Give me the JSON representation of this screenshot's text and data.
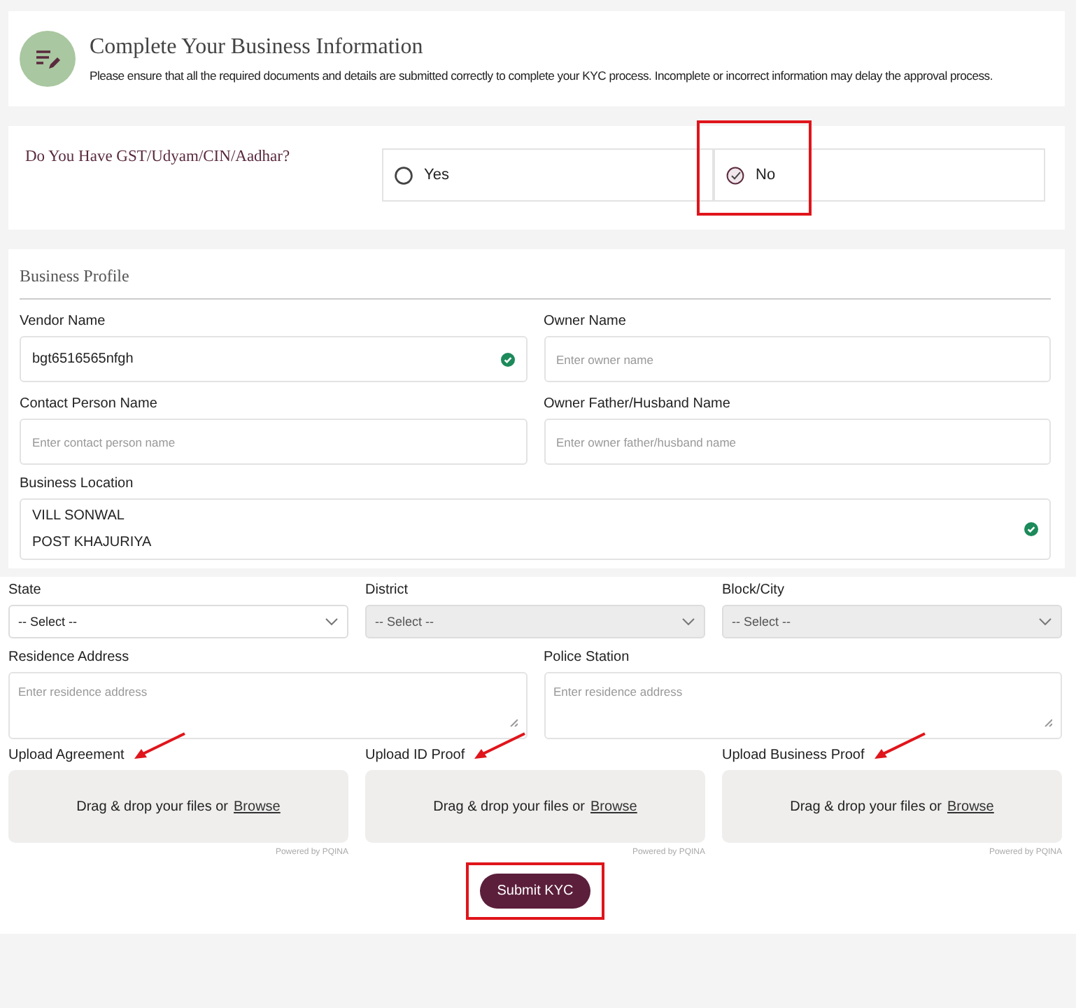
{
  "header": {
    "title": "Complete Your Business Information",
    "description": "Please ensure that all the required documents and details are submitted correctly to complete your KYC process. Incomplete or incorrect information may delay the approval process."
  },
  "question": {
    "label": "Do You Have GST/Udyam/CIN/Aadhar?",
    "options": [
      {
        "label": "Yes",
        "selected": false,
        "highlighted": false
      },
      {
        "label": "No",
        "selected": true,
        "highlighted": true
      }
    ]
  },
  "profile": {
    "title": "Business Profile",
    "fields": [
      {
        "label": "Vendor Name",
        "value": "bgt6516565nfgh",
        "valid": true
      },
      {
        "label": "Owner Name",
        "placeholder": "Enter owner name",
        "valid": false
      },
      {
        "label": "Contact Person Name",
        "placeholder": "Enter contact person name",
        "valid": false
      },
      {
        "label": "Owner Father/Husband Name",
        "placeholder": "Enter owner father/husband name",
        "valid": false
      }
    ],
    "location": {
      "label": "Business Location",
      "lines": [
        "VILL SONWAL",
        "POST KHAJURIYA"
      ],
      "valid": true
    }
  },
  "selects": [
    {
      "label": "State",
      "value": "-- Select --",
      "disabled": false
    },
    {
      "label": "District",
      "value": "-- Select --",
      "disabled": true
    },
    {
      "label": "Block/City",
      "value": "-- Select --",
      "disabled": true
    }
  ],
  "addresses": [
    {
      "label": "Residence Address",
      "placeholder": "Enter residence address"
    },
    {
      "label": "Police Station",
      "placeholder": "Enter residence address"
    }
  ],
  "uploads": [
    {
      "label": "Upload Agreement",
      "prompt": "Drag & drop your files or",
      "link": "Browse",
      "credit": "Powered by PQINA",
      "annotated": true
    },
    {
      "label": "Upload ID Proof",
      "prompt": "Drag & drop your files or",
      "link": "Browse",
      "credit": "Powered by PQINA",
      "annotated": true
    },
    {
      "label": "Upload Business Proof",
      "prompt": "Drag & drop your files or",
      "link": "Browse",
      "credit": "Powered by PQINA",
      "annotated": true
    }
  ],
  "submit": {
    "label": "Submit KYC",
    "highlighted": true
  }
}
